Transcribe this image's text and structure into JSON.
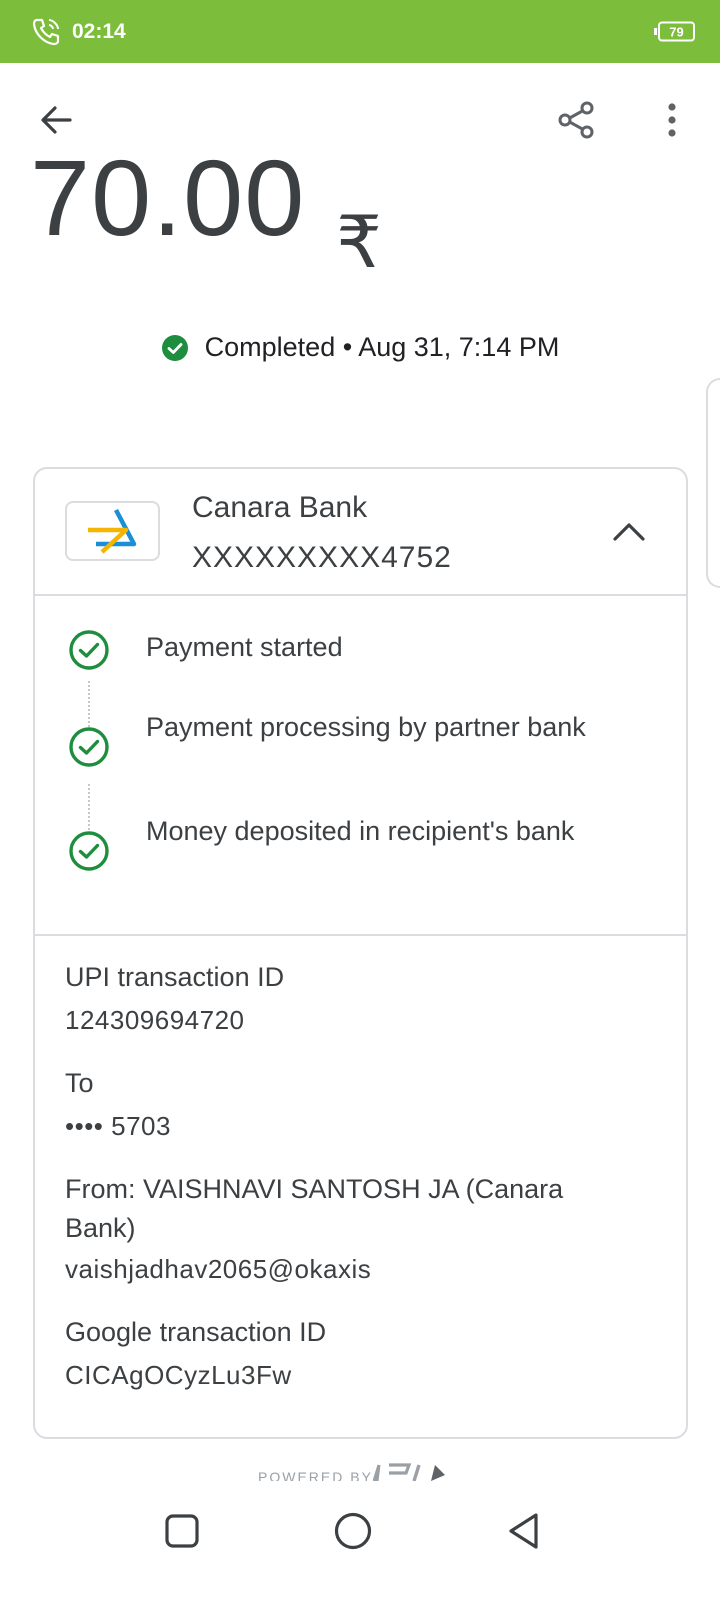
{
  "status_bar": {
    "time": "02:14",
    "battery": "79",
    "color": "#7cbd3b"
  },
  "app_bar": {
    "back_icon": "arrow-left-icon",
    "share_icon": "share-icon",
    "more_icon": "more-vert-icon"
  },
  "payment": {
    "currency_symbol": "₹",
    "amount": "70.00",
    "status": "Completed",
    "separator": "•",
    "datetime": "Aug 31, 7:14 PM"
  },
  "bank": {
    "name": "Canara Bank",
    "account": "XXXXXXXXX4752"
  },
  "steps": [
    {
      "label": "Payment started"
    },
    {
      "label": "Payment processing by partner bank"
    },
    {
      "label": "Money deposited in recipient's bank"
    }
  ],
  "details": {
    "upi_label": "UPI transaction ID",
    "upi_value": "124309694720",
    "to_label": "To",
    "to_value": "•••• 5703",
    "from_label": "From: VAISHNAVI SANTOSH JA (Canara Bank)",
    "from_value": "vaishjadhav2065@okaxis",
    "google_label": "Google transaction ID",
    "google_value": "CICAgOCyzLu3Fw"
  },
  "footer": {
    "powered_by": "POWERED BY",
    "brand": "UPI"
  },
  "colors": {
    "success": "#1e8e3e",
    "text": "#3c4043",
    "border": "#dadce0"
  }
}
